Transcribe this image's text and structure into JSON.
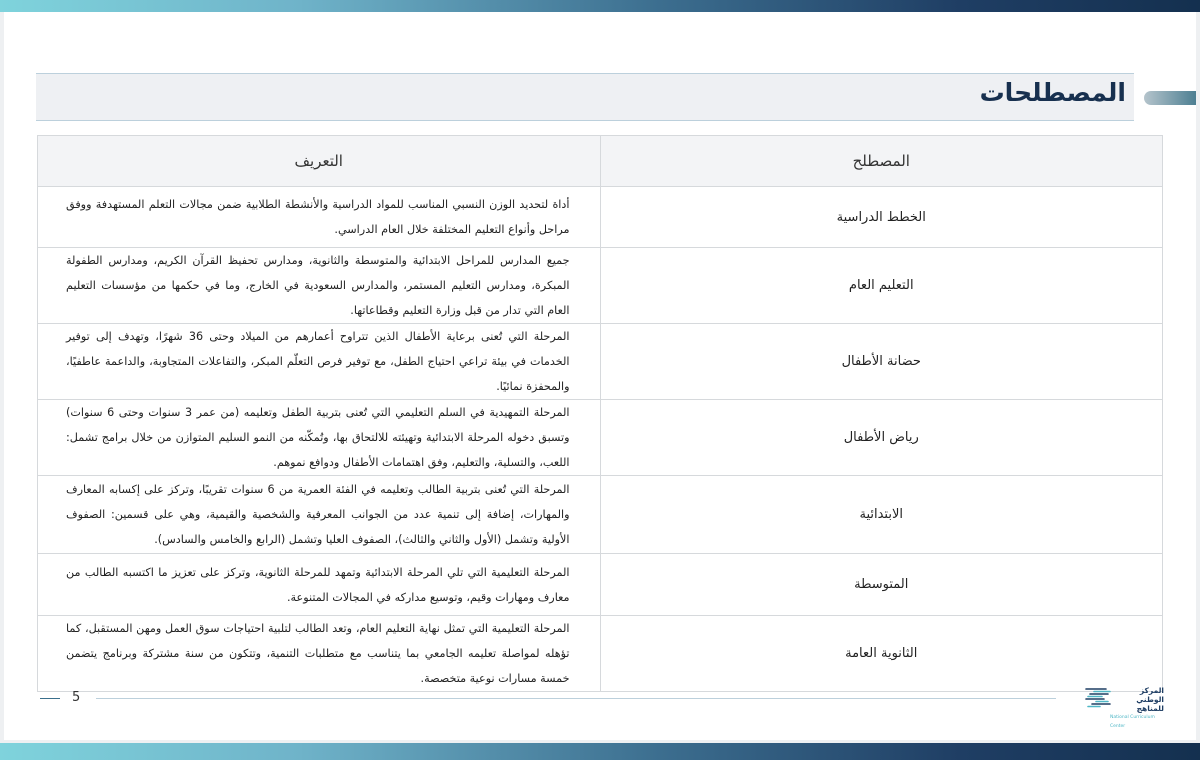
{
  "page": {
    "title": "المصطلحات",
    "page_number": "5"
  },
  "table": {
    "headers": {
      "term": "المصطلح",
      "definition": "التعريف"
    },
    "rows": [
      {
        "term": "الخطط الدراسية",
        "definition": "أداة لتحديد الوزن النسبي المناسب للمواد الدراسية والأنشطة الطلابية ضمن مجالات التعلم المستهدفة ووفق مراحل وأنواع التعليم المختلفة خلال العام الدراسي."
      },
      {
        "term": "التعليم العام",
        "definition": "جميع المدارس للمراحل الابتدائية والمتوسطة والثانوية، ومدارس تحفيظ القرآن الكريم، ومدارس الطفولة المبكرة، ومدارس التعليم المستمر، والمدارس السعودية في الخارج، وما في حكمها من مؤسسات التعليم العام التي تدار من قبل وزارة التعليم وقطاعاتها."
      },
      {
        "term": "حضانة الأطفال",
        "definition": "المرحلة التي تُعنى برعاية الأطفال الذين تتراوح أعمارهم من الميلاد وحتى 36 شهرًا، وتهدف إلى توفير الخدمات في بيئة تراعي احتياج الطفل، مع توفير فرص التعلّم المبكر، والتفاعلات المتجاوبة، والداعمة عاطفيًا، والمحفزة نمائيًا."
      },
      {
        "term": "رياض الأطفال",
        "definition": "المرحلة التمهيدية في السلم التعليمي التي تُعنى بتربية الطفل وتعليمه (من عمر 3 سنوات وحتى 6 سنوات) وتسبق دخوله المرحلة الابتدائية وتهيئته للالتحاق بها، وتُمكّنه من النمو السليم المتوازن من خلال برامج تشمل: اللعب، والتسلية، والتعليم، وفق اهتمامات الأطفال ودوافع نموهم."
      },
      {
        "term": "الابتدائية",
        "definition": "المرحلة التي تُعنى بتربية الطالب وتعليمه في الفئة العمرية من 6 سنوات تقريبًا، وتركز على إكسابه المعارف والمهارات، إضافة إلى تنمية عدد من الجوانب المعرفية والشخصية والقيمية، وهي على قسمين: الصفوف الأولية وتشمل (الأول والثاني والثالث)، الصفوف العليا وتشمل (الرابع والخامس والسادس)."
      },
      {
        "term": "المتوسطة",
        "definition": "المرحلة التعليمية التي تلي المرحلة الابتدائية وتمهد للمرحلة الثانوية، وتركز على تعزيز ما اكتسبه الطالب من معارف ومهارات وقيم، وتوسيع مداركه في المجالات المتنوعة."
      },
      {
        "term": "الثانوية العامة",
        "definition": "المرحلة التعليمية التي تمثل نهاية التعليم العام، وتعد الطالب لتلبية احتياجات سوق العمل ومهن المستقبل، كما تؤهله لمواصلة تعليمه الجامعي بما يتناسب مع متطلبات التنمية، وتتكون من سنة مشتركة وبرنامج يتضمن خمسة مسارات نوعية متخصصة."
      }
    ]
  },
  "logo": {
    "line1": "المركز الوطني",
    "line2": "للمناهج",
    "line3": "National Curriculum Center"
  },
  "colors": {
    "brand_dark": "#17304f",
    "brand_teal": "#4d7f92",
    "band_light": "#7fd3dc"
  }
}
